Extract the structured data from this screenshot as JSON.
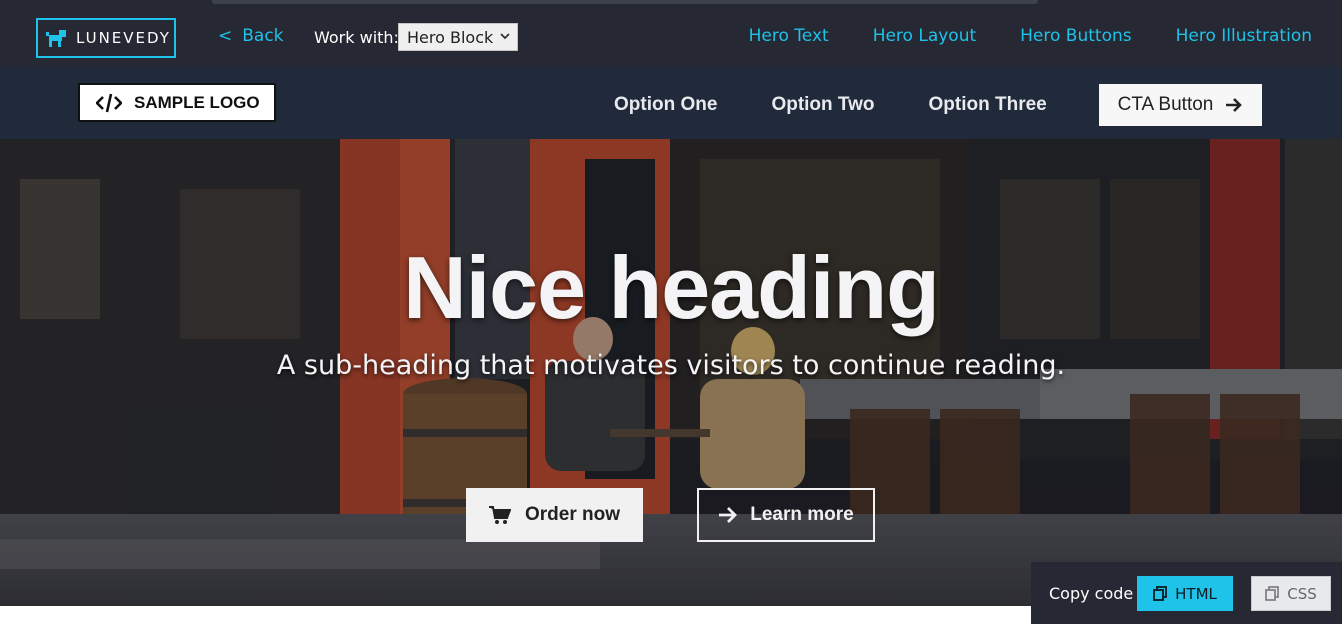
{
  "app": {
    "brand": "LUNEVEDY",
    "back_label": "Back",
    "work_with_label": "Work with:",
    "work_with_selected": "Hero Block",
    "tabs": [
      "Hero Text",
      "Hero Layout",
      "Hero Buttons",
      "Hero Illustration"
    ],
    "accent_color": "#1fc2e8"
  },
  "navbar": {
    "logo_text": "SAMPLE LOGO",
    "links": [
      "Option One",
      "Option Two",
      "Option Three"
    ],
    "cta_label": "CTA Button"
  },
  "hero": {
    "heading": "Nice heading",
    "subheading": "A sub-heading that motivates visitors to continue reading.",
    "primary_button": "Order now",
    "secondary_button": "Learn more"
  },
  "copy_panel": {
    "label": "Copy code",
    "html_button": "HTML",
    "css_button": "CSS"
  },
  "icons": {
    "brand": "dog-icon",
    "logo": "code-icon",
    "cta": "arrow-right-icon",
    "order": "cart-icon",
    "learn": "arrow-right-icon",
    "copy": "copy-icon"
  }
}
